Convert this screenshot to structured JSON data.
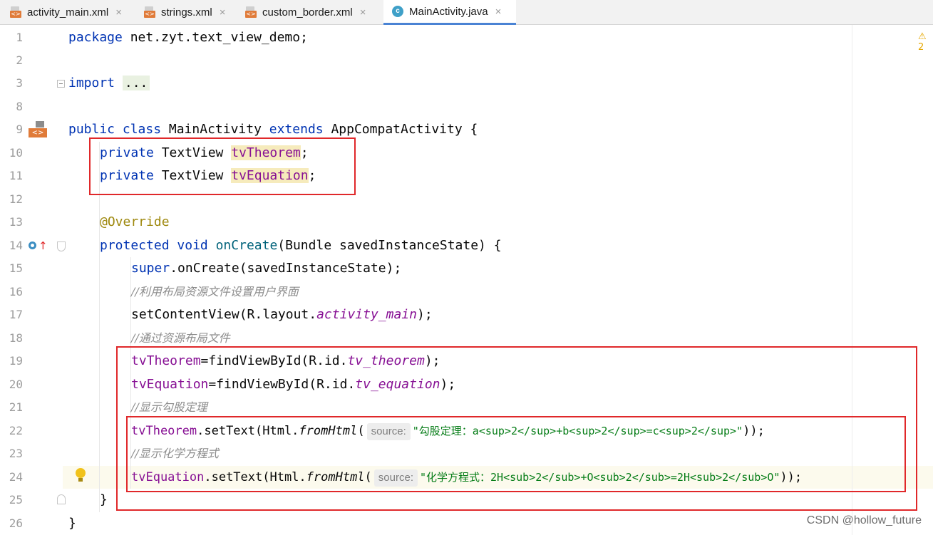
{
  "tabs": [
    {
      "label": "activity_main.xml",
      "icon": "xml-file-icon"
    },
    {
      "label": "strings.xml",
      "icon": "xml-file-icon"
    },
    {
      "label": "custom_border.xml",
      "icon": "xml-file-icon"
    },
    {
      "label": "MainActivity.java",
      "icon": "java-class-icon",
      "active": true
    }
  ],
  "editor": {
    "line_numbers": [
      "1",
      "2",
      "3",
      "8",
      "9",
      "10",
      "11",
      "12",
      "13",
      "14",
      "15",
      "16",
      "17",
      "18",
      "19",
      "20",
      "21",
      "22",
      "23",
      "24",
      "25",
      "26"
    ],
    "lines": {
      "l1": {
        "kw": "package",
        "rest": " net.zyt.text_view_demo;"
      },
      "l3": {
        "kw": "import",
        "rest": "..."
      },
      "l9": {
        "kw1": "public class",
        "name": " MainActivity ",
        "kw2": "extends",
        "rest": " AppCompatActivity {"
      },
      "l10": {
        "kw": "private",
        "type": " TextView ",
        "field": "tvTheorem",
        "end": ";"
      },
      "l11": {
        "kw": "private",
        "type": " TextView ",
        "field": "tvEquation",
        "end": ";"
      },
      "l13": {
        "annotation": "@Override"
      },
      "l14": {
        "kw1": "protected",
        "kw2": "void",
        "method": "onCreate",
        "rest": "(Bundle savedInstanceState) {"
      },
      "l15": {
        "kw": "super",
        "rest": ".onCreate(savedInstanceState);"
      },
      "l16": {
        "comment": "//利用布局资源文件设置用户界面"
      },
      "l17": {
        "a": "setContentView(R.layout.",
        "b": "activity_main",
        "c": ");"
      },
      "l18": {
        "comment": "//通过资源布局文件"
      },
      "l19": {
        "field": "tvTheorem",
        "a": "=findViewById(R.id.",
        "b": "tv_theorem",
        "c": ");"
      },
      "l20": {
        "field": "tvEquation",
        "a": "=findViewById(R.id.",
        "b": "tv_equation",
        "c": ");"
      },
      "l21": {
        "comment": "//显示勾股定理"
      },
      "l22": {
        "field": "tvTheorem",
        "a": ".setText(Html.",
        "b": "fromHtml",
        "c": "(",
        "hint": "source:",
        "str": "\"勾股定理：a<sup>2</sup>+b<sup>2</sup>=c<sup>2</sup>\"",
        "end": "));"
      },
      "l23": {
        "comment": "//显示化学方程式"
      },
      "l24": {
        "field": "tvEquation",
        "a": ".setText(Html.",
        "b": "fromHtml",
        "c": "(",
        "hint": "source:",
        "str": "\"化学方程式：2H<sub>2</sub>+O<sub>2</sub>=2H<sub>2</sub>O\"",
        "end": "));"
      },
      "l25": {
        "text": "}"
      },
      "l26": {
        "text": "}"
      }
    },
    "warning_badge": "⚠ 2",
    "colors": {
      "keyword": "#0033b3",
      "field": "#871094",
      "annotation": "#9e880d",
      "method": "#00627a",
      "comment": "#8c8c8c",
      "string": "#067d17",
      "highlight_box": "#e0282a"
    }
  },
  "watermark": "CSDN @hollow_future"
}
